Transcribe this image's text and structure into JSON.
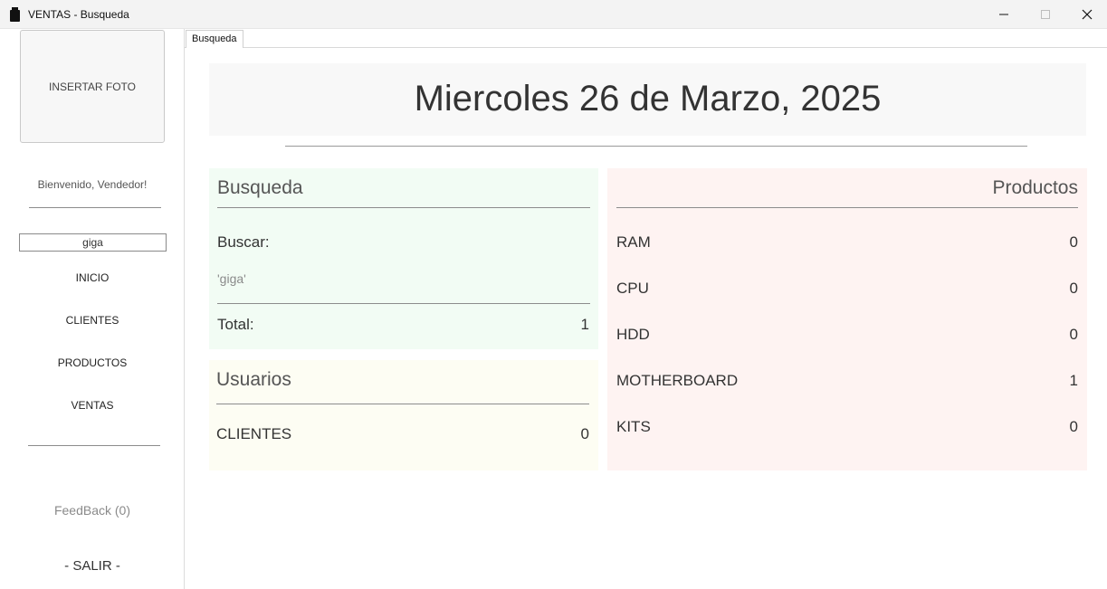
{
  "window": {
    "title": "VENTAS - Busqueda"
  },
  "sidebar": {
    "photo_label": "INSERTAR FOTO",
    "welcome": "Bienvenido, Vendedor!",
    "search_value": "giga",
    "nav": [
      "INICIO",
      "CLIENTES",
      "PRODUCTOS",
      "VENTAS"
    ],
    "feedback": "FeedBack (0)",
    "exit": "- SALIR -"
  },
  "tabs": [
    "Busqueda"
  ],
  "header": {
    "date": "Miercoles 26 de Marzo, 2025"
  },
  "busqueda": {
    "title": "Busqueda",
    "search_label": "Buscar:",
    "query": "'giga'",
    "total_label": "Total:",
    "total_value": "1"
  },
  "usuarios": {
    "title": "Usuarios",
    "rows": [
      {
        "label": "CLIENTES",
        "value": "0"
      }
    ]
  },
  "productos": {
    "title": "Productos",
    "rows": [
      {
        "label": "RAM",
        "value": "0"
      },
      {
        "label": "CPU",
        "value": "0"
      },
      {
        "label": "HDD",
        "value": "0"
      },
      {
        "label": "MOTHERBOARD",
        "value": "1"
      },
      {
        "label": "KITS",
        "value": "0"
      }
    ]
  },
  "colors": {
    "busqueda_bg": "#f2fcf4",
    "usuarios_bg": "#fdfdf3",
    "productos_bg": "#fef3f2",
    "header_bg": "#f8f8f8"
  }
}
